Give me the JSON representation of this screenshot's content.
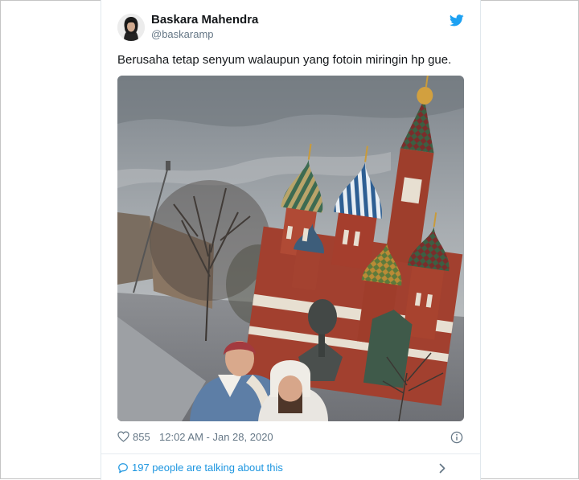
{
  "tweet": {
    "author_name": "Baskara Mahendra",
    "author_handle": "@baskaramp",
    "text": "Berusaha tetap senyum walaupun yang fotoin miringin hp gue.",
    "like_count": "855",
    "timestamp": "12:02 AM - Jan 28, 2020",
    "conversation_text": "197 people are talking about this"
  },
  "icons": {
    "brand": "twitter-bird-icon",
    "like": "heart-icon",
    "info": "info-icon",
    "conversation": "speech-bubble-icon",
    "chevron": "chevron-right-icon"
  },
  "colors": {
    "brand_blue": "#1da1f2",
    "link_blue": "#1b95e0",
    "secondary_text": "#657786",
    "primary_text": "#14171a",
    "divider": "#e6ecf0"
  }
}
